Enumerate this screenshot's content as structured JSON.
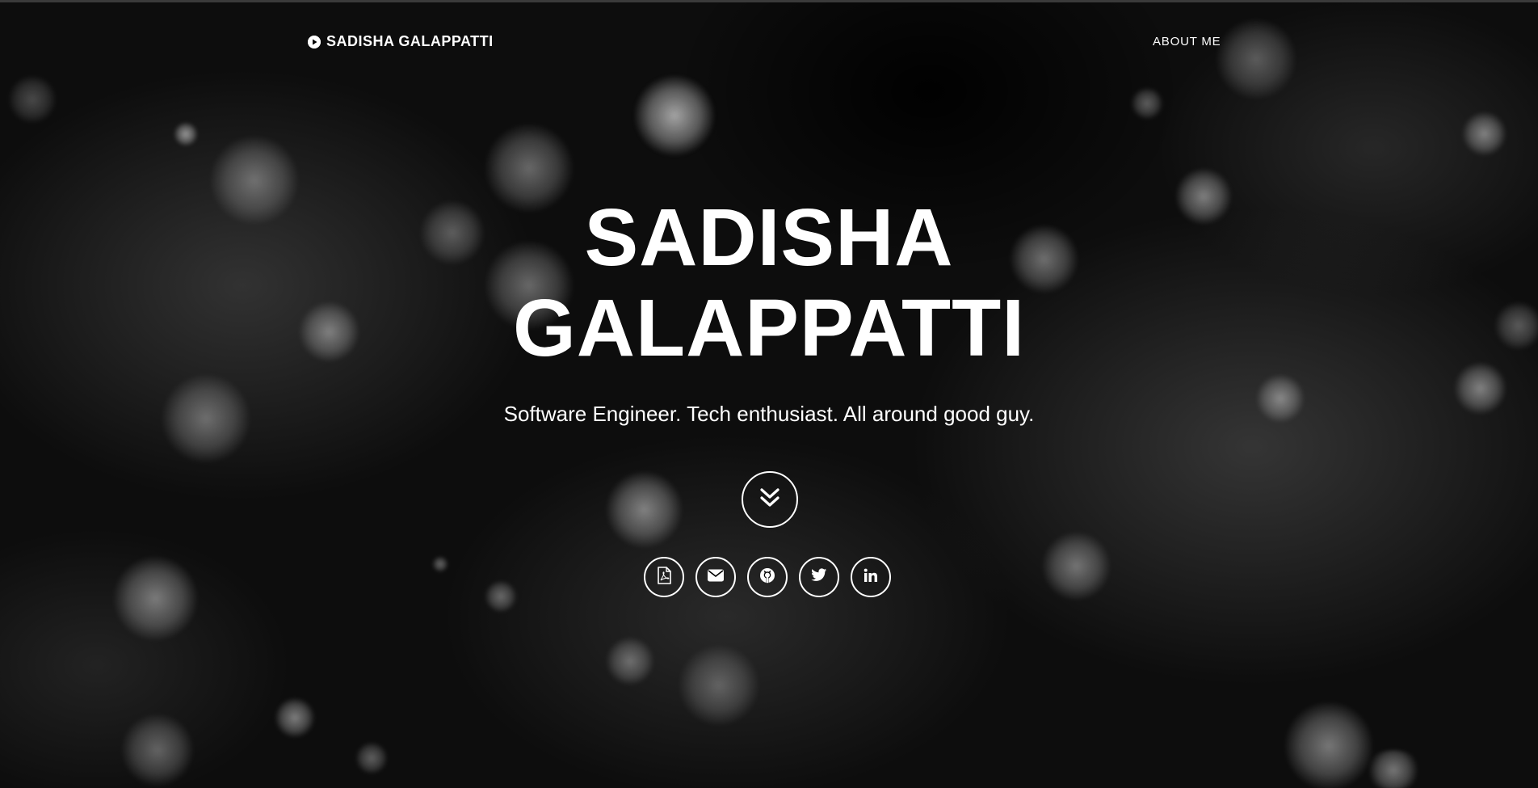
{
  "navbar": {
    "brand_label": "SADISHA GALAPPATTI",
    "brand_icon": "play-circle-icon",
    "links": [
      {
        "label": "ABOUT ME"
      }
    ]
  },
  "hero": {
    "title_line1": "SADISHA",
    "title_line2": "GALAPPATTI",
    "subtitle": "Software Engineer. Tech enthusiast. All around good guy.",
    "scroll_icon": "double-chevron-down-icon"
  },
  "social_links": [
    {
      "icon": "pdf-file-icon"
    },
    {
      "icon": "envelope-icon"
    },
    {
      "icon": "github-icon"
    },
    {
      "icon": "twitter-icon"
    },
    {
      "icon": "linkedin-icon"
    }
  ],
  "colors": {
    "text": "#ffffff",
    "background": "#000000"
  }
}
